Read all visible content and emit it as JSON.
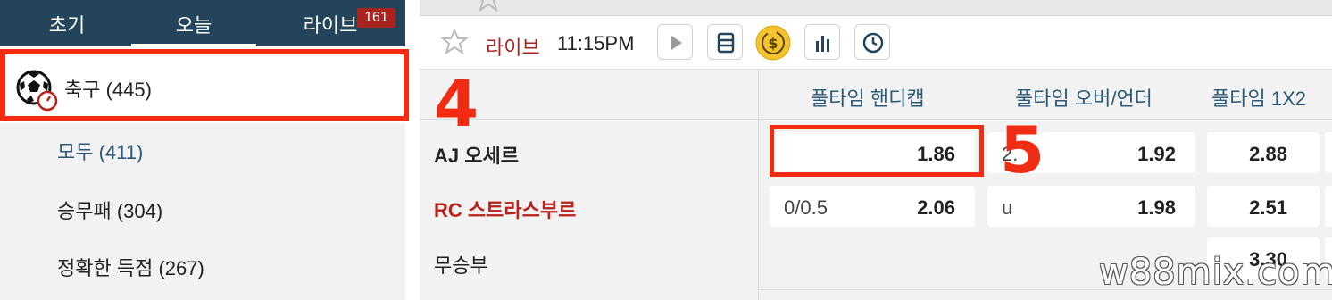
{
  "sidebar": {
    "tabs": [
      {
        "label": "초기"
      },
      {
        "label": "오늘"
      },
      {
        "label": "라이브",
        "badge": "161"
      }
    ],
    "sport": {
      "label": "축구",
      "count": "(445)",
      "icon": "soccer-ball-icon"
    },
    "sub_items": [
      {
        "label": "모두",
        "count": "(411)"
      },
      {
        "label": "승무패",
        "count": "(304)"
      },
      {
        "label": "정확한 득점",
        "count": "(267)"
      }
    ]
  },
  "toolbar": {
    "live_label": "라이브",
    "time": "11:15PM",
    "icons": [
      "star-icon",
      "play-icon",
      "coupon-icon",
      "cash-coin-icon",
      "stats-icon",
      "clock-icon"
    ]
  },
  "annotations": {
    "step4": "4",
    "step5": "5"
  },
  "market": {
    "columns": [
      "풀타임 핸디캡",
      "풀타임 오버/언더",
      "풀타임 1X2"
    ],
    "teams": {
      "home": "AJ 오세르",
      "away": "RC 스트라스부르",
      "draw": "무승부"
    },
    "handicap": {
      "home_odd": "1.86",
      "away_line": "0/0.5",
      "away_odd": "2.06"
    },
    "over_under": {
      "over_line": "2.",
      "over_odd": "1.92",
      "under_line": "u",
      "under_odd": "1.98"
    },
    "one_x_two": {
      "home": "2.88",
      "away": "2.51",
      "draw": "3.30"
    }
  },
  "watermark": "w88mix.com",
  "colors": {
    "nav_bg": "#23445a",
    "highlight": "#f22c12",
    "live_red": "#a9231f",
    "header_blue": "#2a5a78"
  }
}
